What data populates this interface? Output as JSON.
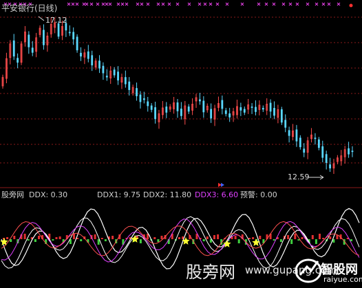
{
  "header": {
    "title": "平安银行(日线)",
    "title_color": "#cccccc",
    "top_right_marker_color": "#ff3030"
  },
  "price_chart": {
    "high_label": "17.12",
    "low_label": "12.59",
    "bull_color": "#ff4d4d",
    "bear_color": "#5ad8ff",
    "grid_color": "#8b1a1a",
    "cross_color": "#e040e0"
  },
  "indicator": {
    "name": "股旁网",
    "ddx_label": "DDX: 0.30",
    "ddx1_label": "DDX1: 9.75",
    "ddx2_label": "DDX2: 11.80",
    "ddx3_label": "DDX3: 6.60",
    "warn_label": "预警: 0.00",
    "text_color": "#d0d0d0",
    "ddx3_color": "#e040ff",
    "star_color": "#ffff33"
  },
  "watermark": {
    "site_cn": "股旁网",
    "site_url": "www.gupang.com",
    "logo_text": "智股网",
    "logo_url": "raiyue.com"
  },
  "chart_data": {
    "type": "candlestick",
    "title": "平安银行(日线)",
    "annotations": [
      {
        "text": "17.12",
        "type": "high"
      },
      {
        "text": "12.59",
        "type": "low"
      }
    ],
    "close": [
      15.4,
      15.95,
      16.38,
      16.02,
      15.84,
      16.38,
      16.73,
      16.29,
      16.13,
      16.56,
      16.84,
      16.35,
      16.61,
      16.95,
      17.0,
      16.6,
      16.89,
      16.78,
      16.72,
      16.52,
      16.2,
      16.02,
      16.12,
      15.95,
      15.76,
      15.88,
      15.67,
      15.53,
      15.41,
      15.59,
      15.47,
      15.32,
      15.4,
      15.21,
      15.04,
      15.11,
      14.86,
      14.69,
      14.75,
      14.57,
      14.46,
      14.19,
      14.34,
      14.51,
      14.38,
      14.54,
      14.66,
      14.42,
      14.28,
      14.57,
      14.41,
      14.62,
      14.81,
      14.71,
      14.39,
      14.56,
      14.21,
      14.49,
      14.64,
      14.49,
      14.34,
      14.24,
      14.4,
      14.55,
      14.44,
      14.38,
      14.6,
      14.53,
      14.4,
      14.59,
      14.47,
      14.62,
      14.41,
      14.29,
      14.46,
      14.09,
      13.94,
      13.7,
      13.84,
      13.54,
      13.37,
      13.21,
      13.55,
      13.72,
      13.61,
      13.35,
      13.06,
      12.91,
      12.75,
      12.88,
      13.05,
      13.11,
      13.29,
      13.16,
      13.24
    ],
    "high": 17.12,
    "low": 12.59,
    "ddx1": [
      15.0
    ],
    "series_names": [
      "DDX",
      "DDX1",
      "DDX2",
      "DDX3",
      "预警"
    ],
    "latest_values": {
      "DDX": 0.3,
      "DDX1": 9.75,
      "DDX2": 11.8,
      "DDX3": 6.6,
      "预警": 0.0
    },
    "grid": true
  }
}
